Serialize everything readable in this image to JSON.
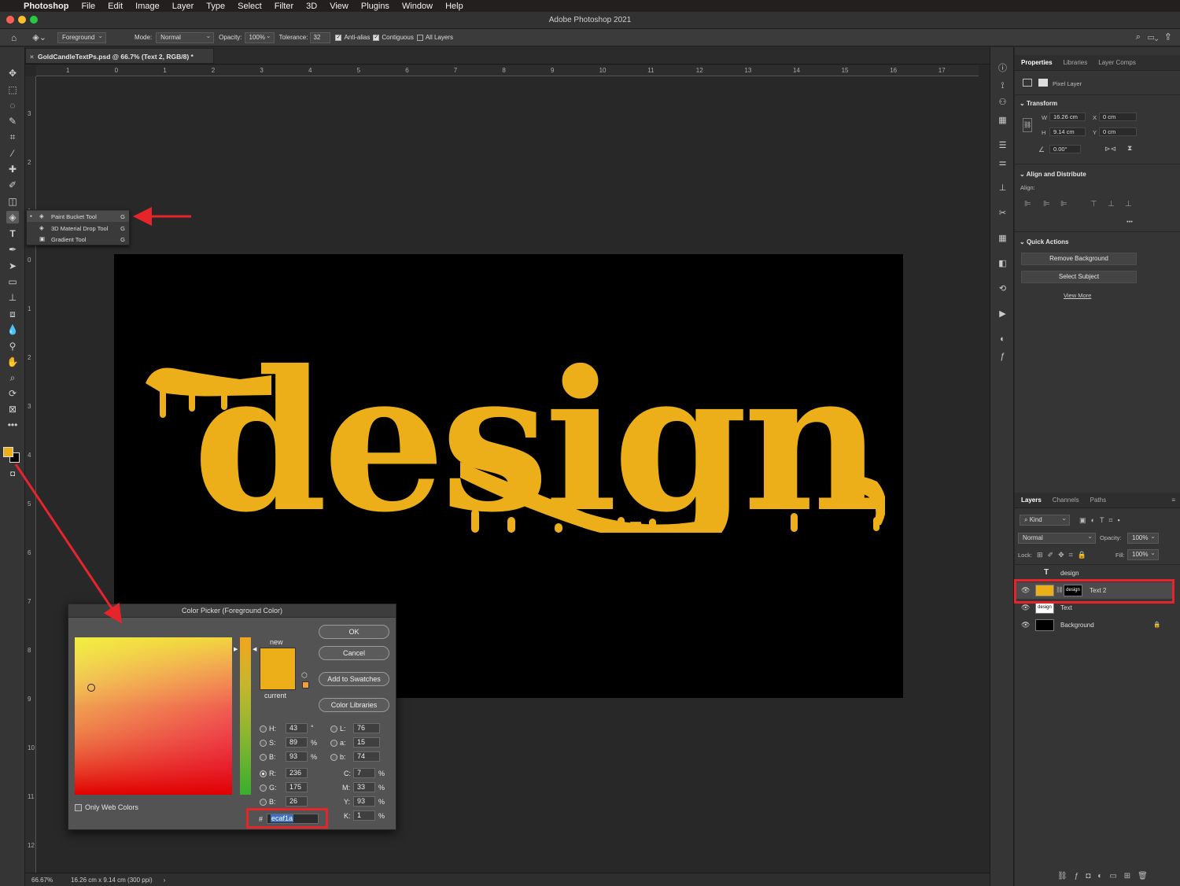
{
  "menubar": {
    "app": "Photoshop",
    "items": [
      "File",
      "Edit",
      "Image",
      "Layer",
      "Type",
      "Select",
      "Filter",
      "3D",
      "View",
      "Plugins",
      "Window",
      "Help"
    ]
  },
  "window": {
    "title": "Adobe Photoshop 2021"
  },
  "options": {
    "fill_source": "Foreground",
    "mode_label": "Mode:",
    "mode_value": "Normal",
    "opacity_label": "Opacity:",
    "opacity_value": "100%",
    "tolerance_label": "Tolerance:",
    "tolerance_value": "32",
    "antialias": "Anti-alias",
    "contiguous": "Contiguous",
    "all_layers": "All Layers"
  },
  "document": {
    "tab": "GoldCandleTextPs.psd @ 66.7% (Text 2, RGB/8) *",
    "word": "design"
  },
  "ruler_h": [
    "1",
    "0",
    "1",
    "2",
    "3",
    "4",
    "5",
    "6",
    "7",
    "8",
    "9",
    "10",
    "11",
    "12",
    "13",
    "14",
    "15",
    "16",
    "17"
  ],
  "ruler_v": [
    "3",
    "2",
    "1",
    "0",
    "1",
    "2",
    "3",
    "4",
    "5",
    "6",
    "7",
    "8",
    "9",
    "10",
    "11",
    "12"
  ],
  "flyout": [
    {
      "name": "Paint Bucket Tool",
      "key": "G"
    },
    {
      "name": "3D Material Drop Tool",
      "key": "G"
    },
    {
      "name": "Gradient Tool",
      "key": "G"
    }
  ],
  "status": {
    "zoom": "66.67%",
    "info": "16.26 cm x 9.14 cm (300 ppi)"
  },
  "properties": {
    "tabs": [
      "Properties",
      "Libraries",
      "Layer Comps"
    ],
    "layer_type": "Pixel Layer",
    "transform_title": "Transform",
    "w_label": "W",
    "w": "16.26 cm",
    "h_label": "H",
    "h": "9.14 cm",
    "x_label": "X",
    "x": "0 cm",
    "y_label": "Y",
    "y": "0 cm",
    "angle": "0.00°",
    "align_title": "Align and Distribute",
    "align_label": "Align:",
    "more": "•••",
    "quick_title": "Quick Actions",
    "remove_bg": "Remove Background",
    "select_subject": "Select Subject",
    "view_more": "View More"
  },
  "layers": {
    "tabs": [
      "Layers",
      "Channels",
      "Paths"
    ],
    "filter": "Kind",
    "blend": "Normal",
    "opacity_label": "Opacity:",
    "opacity": "100%",
    "lock_label": "Lock:",
    "fill_label": "Fill:",
    "fill": "100%",
    "rows": [
      {
        "name": "design"
      },
      {
        "name": "Text 2"
      },
      {
        "name": "Text"
      },
      {
        "name": "Background"
      }
    ]
  },
  "picker": {
    "title": "Color Picker (Foreground Color)",
    "new_label": "new",
    "current_label": "current",
    "ok": "OK",
    "cancel": "Cancel",
    "add_swatches": "Add to Swatches",
    "color_libraries": "Color Libraries",
    "only_web": "Only Web Colors",
    "H": "43",
    "S": "89",
    "B": "93",
    "R": "236",
    "G": "175",
    "Bv": "26",
    "L": "76",
    "a": "15",
    "b": "74",
    "C": "7",
    "M": "33",
    "Y": "93",
    "K": "1",
    "deg": "°",
    "pct": "%",
    "hash": "#",
    "hex": "ecaf1a"
  },
  "colors": {
    "foreground": "#ecaf1a",
    "accent_red": "#e5252a"
  }
}
